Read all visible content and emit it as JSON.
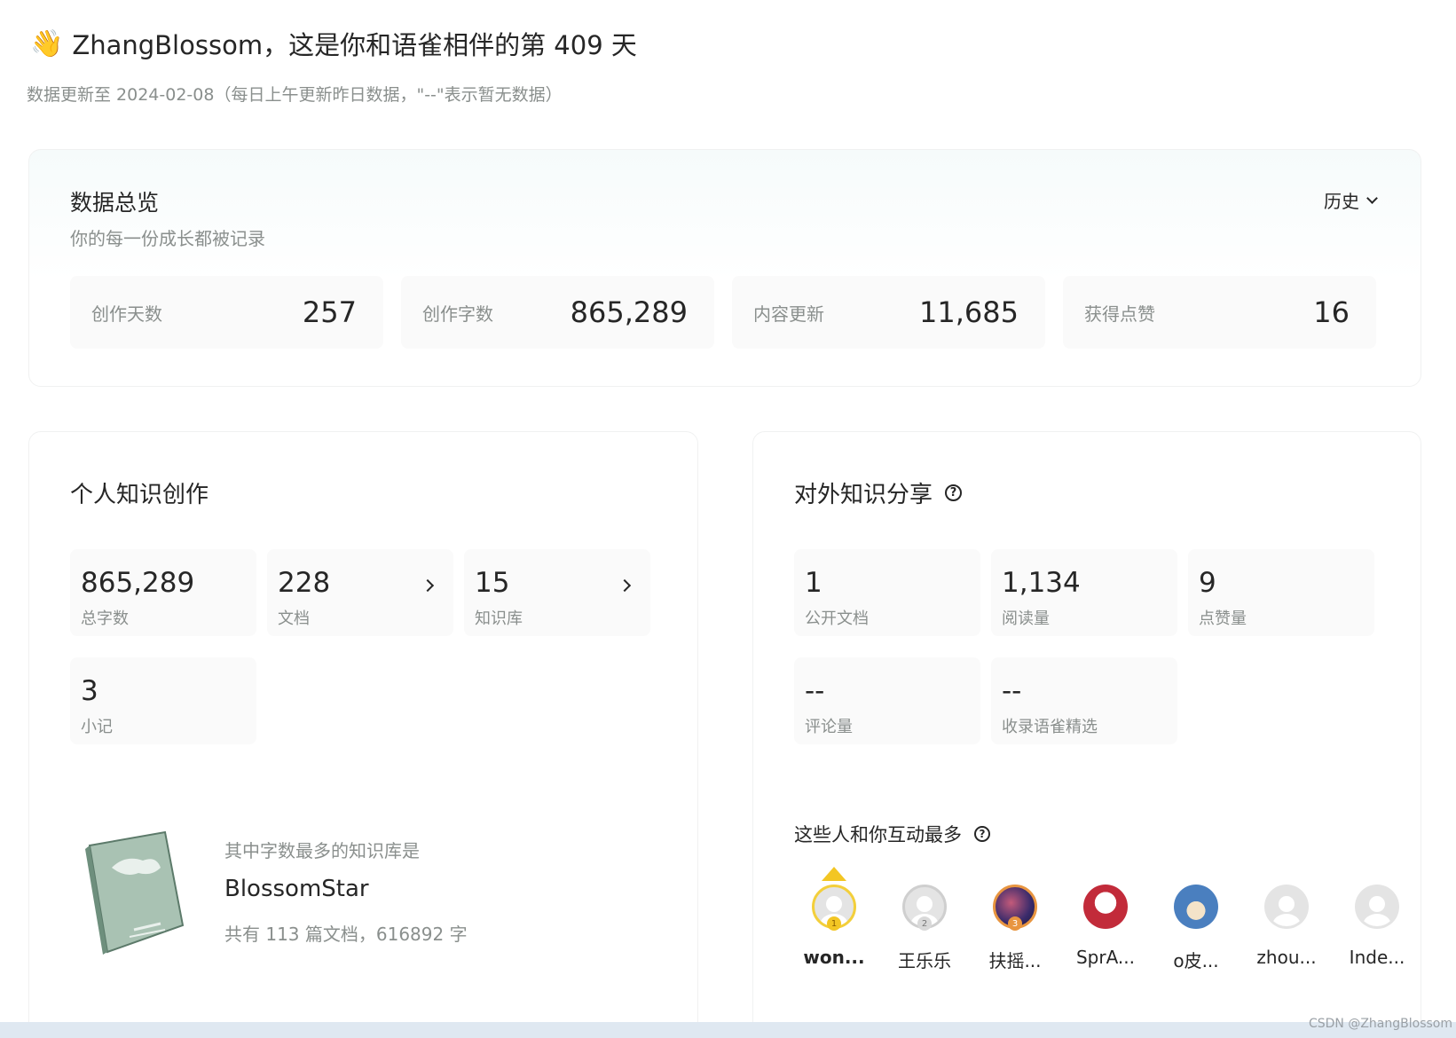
{
  "header": {
    "greeting": "ZhangBlossom，这是你和语雀相伴的第 409 天",
    "subtitle": "数据更新至 2024-02-08（每日上午更新昨日数据，\"--\"表示暂无数据）"
  },
  "overview": {
    "title": "数据总览",
    "desc": "你的每一份成长都被记录",
    "history_label": "历史",
    "stats": [
      {
        "label": "创作天数",
        "value": "257"
      },
      {
        "label": "创作字数",
        "value": "865,289"
      },
      {
        "label": "内容更新",
        "value": "11,685"
      },
      {
        "label": "获得点赞",
        "value": "16"
      }
    ]
  },
  "personal": {
    "title": "个人知识创作",
    "tiles": [
      {
        "value": "865,289",
        "label": "总字数"
      },
      {
        "value": "228",
        "label": "文档"
      },
      {
        "value": "15",
        "label": "知识库"
      },
      {
        "value": "3",
        "label": "小记"
      }
    ],
    "kb_intro": "其中字数最多的知识库是",
    "kb_name": "BlossomStar",
    "kb_stats": "共有 113 篇文档，616892 字"
  },
  "sharing": {
    "title": "对外知识分享",
    "tiles": [
      {
        "value": "1",
        "label": "公开文档"
      },
      {
        "value": "1,134",
        "label": "阅读量"
      },
      {
        "value": "9",
        "label": "点赞量"
      },
      {
        "value": "--",
        "label": "评论量"
      },
      {
        "value": "--",
        "label": "收录语雀精选"
      }
    ],
    "interact_title": "这些人和你互动最多",
    "people": [
      {
        "name": "won...",
        "rank": "1"
      },
      {
        "name": "王乐乐",
        "rank": "2"
      },
      {
        "name": "扶摇...",
        "rank": "3"
      },
      {
        "name": "SprA..."
      },
      {
        "name": "o皮..."
      },
      {
        "name": "zhou..."
      },
      {
        "name": "Inde..."
      }
    ]
  },
  "watermark": "CSDN @ZhangBlossom"
}
